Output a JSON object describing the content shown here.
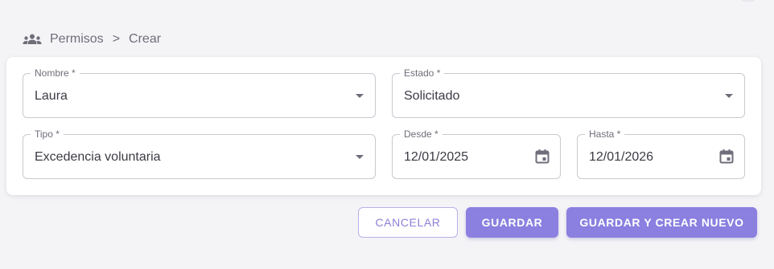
{
  "breadcrumb": {
    "icon": "group-icon",
    "section": "Permisos",
    "separator": ">",
    "current": "Crear"
  },
  "form": {
    "nombre": {
      "label": "Nombre *",
      "value": "Laura"
    },
    "estado": {
      "label": "Estado *",
      "value": "Solicitado"
    },
    "tipo": {
      "label": "Tipo *",
      "value": "Excedencia voluntaria"
    },
    "desde": {
      "label": "Desde *",
      "value": "12/01/2025"
    },
    "hasta": {
      "label": "Hasta *",
      "value": "12/01/2026"
    }
  },
  "actions": {
    "cancel_label": "CANCELAR",
    "save_label": "GUARDAR",
    "save_new_label": "GUARDAR Y CREAR NUEVO"
  },
  "colors": {
    "primary": "#8b7fe0",
    "background": "#f4f4f7"
  }
}
